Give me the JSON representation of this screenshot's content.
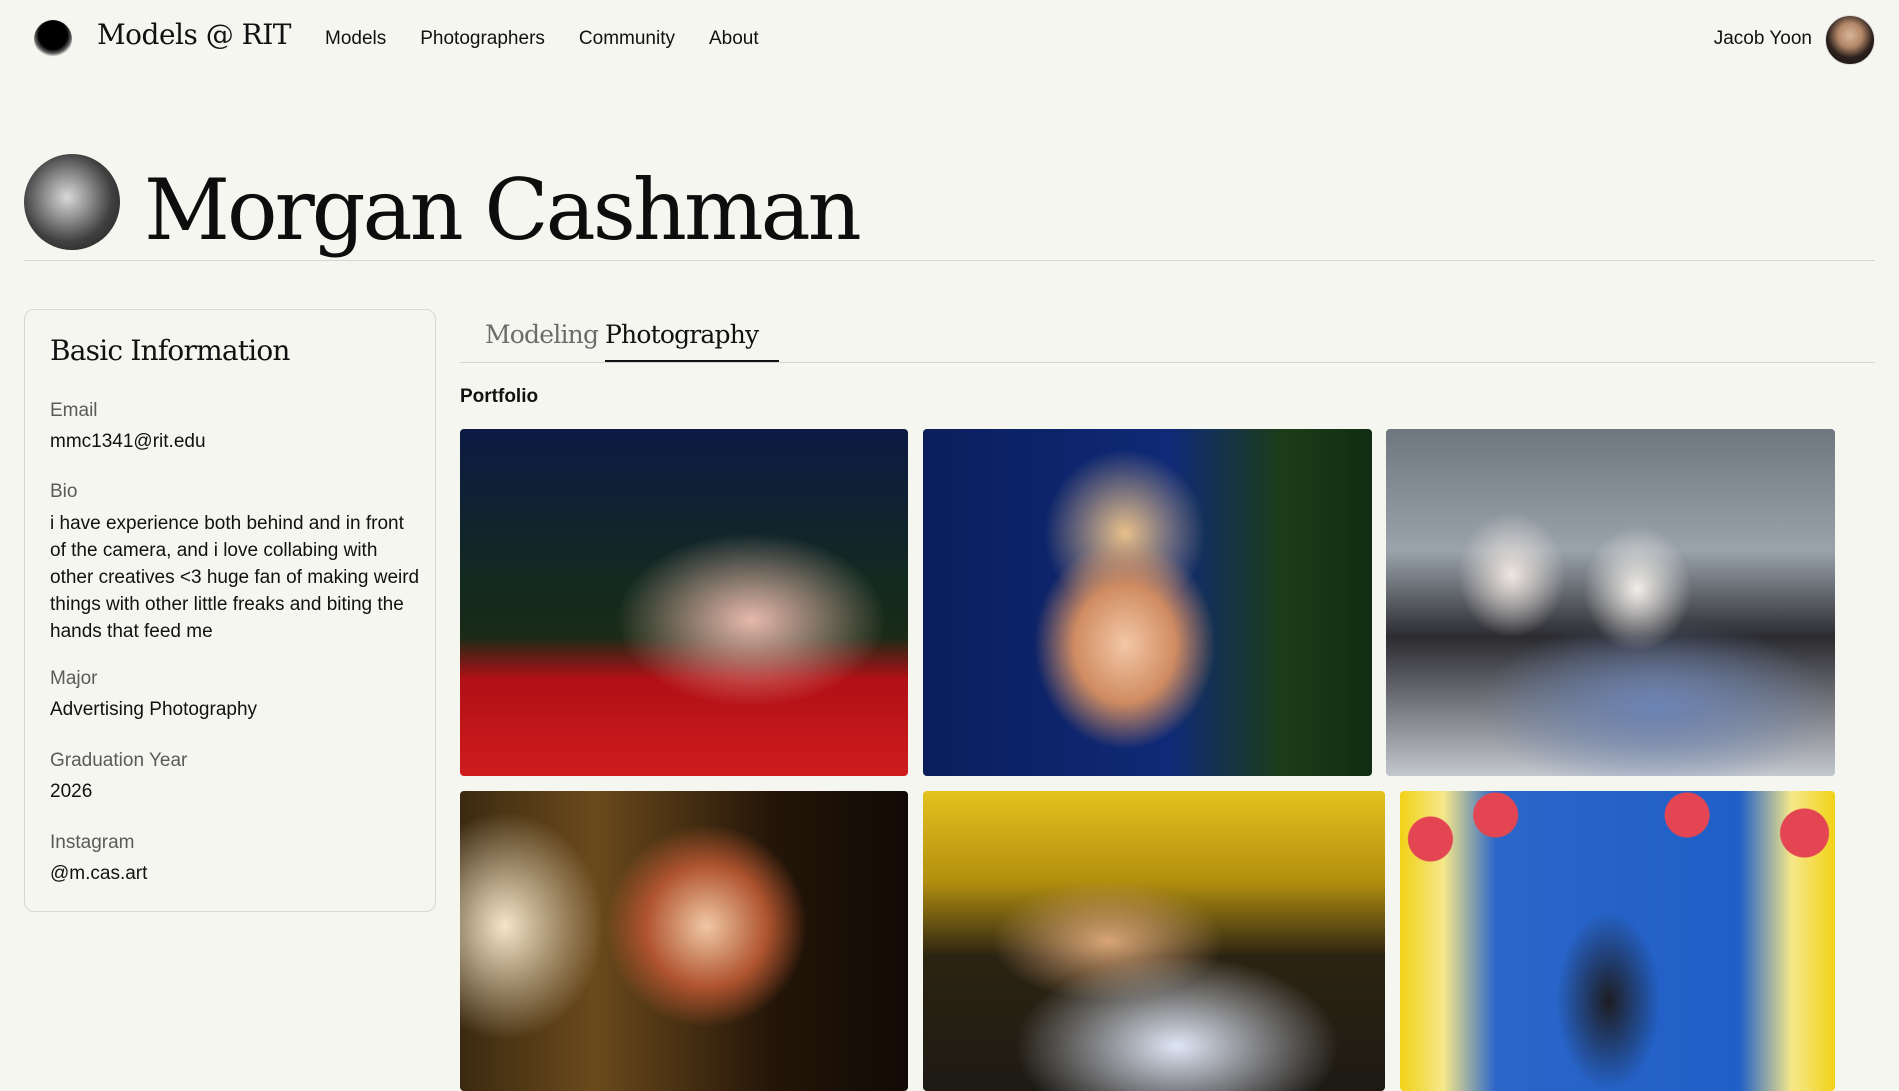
{
  "nav": {
    "brand": "Models @ RIT",
    "links": [
      "Models",
      "Photographers",
      "Community",
      "About"
    ],
    "user_name": "Jacob Yoon"
  },
  "profile": {
    "name": "Morgan Cashman"
  },
  "info_card": {
    "title": "Basic Information",
    "email_label": "Email",
    "email": "mmc1341@rit.edu",
    "bio_label": "Bio",
    "bio": "i have experience both behind and in front of the camera, and i love collabing with other creatives <3 huge fan of making weird things with other little freaks and biting the hands that feed me",
    "major_label": "Major",
    "major": "Advertising Photography",
    "grad_label": "Graduation Year",
    "grad_year": "2026",
    "instagram_label": "Instagram",
    "instagram": "@m.cas.art"
  },
  "tabs": {
    "modeling": "Modeling",
    "photography": "Photography",
    "active": "Photography"
  },
  "portfolio": {
    "title": "Portfolio"
  }
}
